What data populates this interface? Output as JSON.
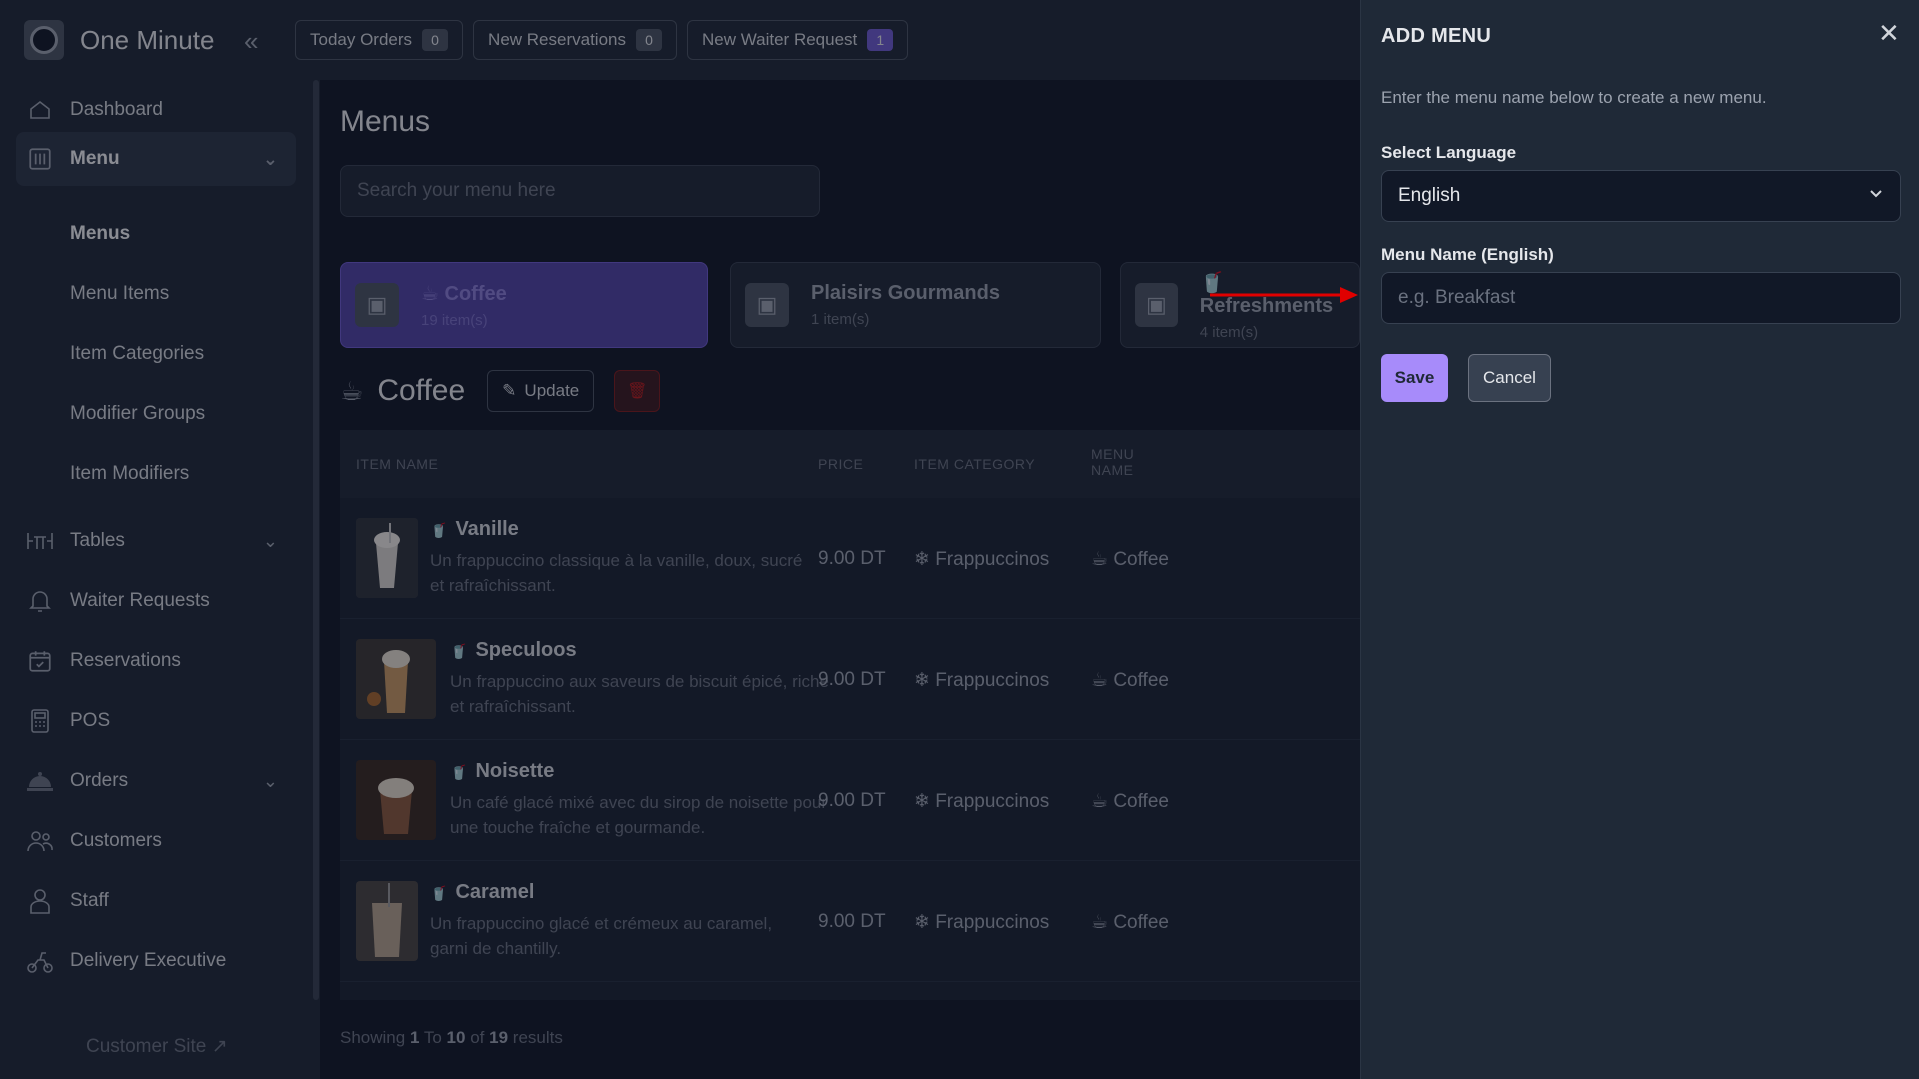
{
  "brand": {
    "name": "One Minute"
  },
  "top_tabs": [
    {
      "label": "Today Orders",
      "count": "0"
    },
    {
      "label": "New Reservations",
      "count": "0"
    },
    {
      "label": "New Waiter Request",
      "count": "1"
    }
  ],
  "sidebar": {
    "dashboard": "Dashboard",
    "menu": "Menu",
    "sub": [
      "Menus",
      "Menu Items",
      "Item Categories",
      "Modifier Groups",
      "Item Modifiers"
    ],
    "tables": "Tables",
    "waiter_requests": "Waiter Requests",
    "reservations": "Reservations",
    "pos": "POS",
    "orders": "Orders",
    "customers": "Customers",
    "staff": "Staff",
    "delivery_executive": "Delivery Executive",
    "customer_site": "Customer Site"
  },
  "main": {
    "title": "Menus",
    "search_placeholder": "Search your menu here",
    "menu_cards": [
      {
        "name": "Coffee",
        "count": "19 item(s)"
      },
      {
        "name": "Plaisirs Gourmands",
        "count": "1 item(s)"
      },
      {
        "name": "Refreshments",
        "count": "4 item(s)"
      }
    ],
    "section_title": "Coffee",
    "update_label": "Update",
    "columns": {
      "item_name": "ITEM NAME",
      "price": "PRICE",
      "item_category": "ITEM CATEGORY",
      "menu_name_1": "MENU",
      "menu_name_2": "NAME"
    },
    "rows": [
      {
        "name": "Vanille",
        "desc": "Un frappuccino classique à la vanille, doux, sucré et rafraîchissant.",
        "price": "9.00 DT",
        "category": "Frappuccinos",
        "menu": "Coffee"
      },
      {
        "name": "Speculoos",
        "desc": "Un frappuccino aux saveurs de biscuit épicé, riche et rafraîchissant.",
        "price": "9.00 DT",
        "category": "Frappuccinos",
        "menu": "Coffee"
      },
      {
        "name": "Noisette",
        "desc": "Un café glacé mixé avec du sirop de noisette pour une touche fraîche et gourmande.",
        "price": "9.00 DT",
        "category": "Frappuccinos",
        "menu": "Coffee"
      },
      {
        "name": "Caramel",
        "desc": "Un frappuccino glacé et crémeux au caramel, garni de chantilly.",
        "price": "9.00 DT",
        "category": "Frappuccinos",
        "menu": "Coffee"
      }
    ],
    "pager": {
      "prefix": "Showing",
      "from": "1",
      "to_word": "To",
      "to": "10",
      "of_word": "of",
      "total": "19",
      "suffix": "results"
    }
  },
  "drawer": {
    "title": "ADD MENU",
    "description": "Enter the menu name below to create a new menu.",
    "language_label": "Select Language",
    "language_value": "English",
    "name_label": "Menu Name (English)",
    "name_placeholder": "e.g. Breakfast",
    "save_label": "Save",
    "cancel_label": "Cancel"
  },
  "colors": {
    "accent": "#a78bfa",
    "annotation": "#e00000"
  }
}
